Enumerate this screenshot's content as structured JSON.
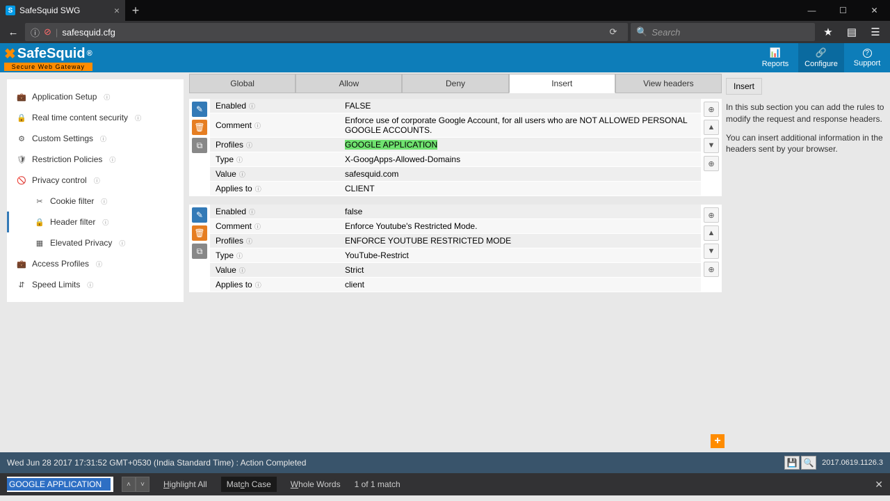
{
  "browser": {
    "tab_title": "SafeSquid SWG",
    "url": "safesquid.cfg",
    "search_placeholder": "Search"
  },
  "header": {
    "logo_main": "SafeSquid",
    "logo_reg": "®",
    "logo_sub": "Secure Web Gateway",
    "nav": [
      {
        "icon": "📊",
        "label": "Reports"
      },
      {
        "icon": "🔗",
        "label": "Configure"
      },
      {
        "icon": "?",
        "label": "Support"
      }
    ]
  },
  "sidebar": {
    "items": [
      {
        "icon": "💼",
        "label": "Application Setup"
      },
      {
        "icon": "🔒",
        "label": "Real time content security"
      },
      {
        "icon": "⚙",
        "label": "Custom Settings"
      },
      {
        "icon": "🛡",
        "label": "Restriction Policies"
      },
      {
        "icon": "🚫",
        "label": "Privacy control"
      }
    ],
    "subs": [
      {
        "icon": "✂",
        "label": "Cookie filter"
      },
      {
        "icon": "🔒",
        "label": "Header filter"
      },
      {
        "icon": "▦",
        "label": "Elevated Privacy"
      }
    ],
    "tail": [
      {
        "icon": "💼",
        "label": "Access Profiles"
      },
      {
        "icon": "⇵",
        "label": "Speed Limits"
      }
    ]
  },
  "tabs": [
    "Global",
    "Allow",
    "Deny",
    "Insert",
    "View headers"
  ],
  "entries": [
    {
      "rows": [
        {
          "label": "Enabled",
          "value": "FALSE"
        },
        {
          "label": "Comment",
          "value": "Enforce use of corporate Google Account, for all users who are NOT ALLOWED PERSONAL GOOGLE ACCOUNTS."
        },
        {
          "label": "Profiles",
          "value": "GOOGLE APPLICATION",
          "highlight": true
        },
        {
          "label": "Type",
          "value": "X-GoogApps-Allowed-Domains"
        },
        {
          "label": "Value",
          "value": "safesquid.com"
        },
        {
          "label": "Applies to",
          "value": "CLIENT"
        }
      ]
    },
    {
      "rows": [
        {
          "label": "Enabled",
          "value": "false"
        },
        {
          "label": "Comment",
          "value": "Enforce Youtube's Restricted Mode."
        },
        {
          "label": "Profiles",
          "value": "ENFORCE YOUTUBE RESTRICTED MODE"
        },
        {
          "label": "Type",
          "value": "YouTube-Restrict"
        },
        {
          "label": "Value",
          "value": "Strict"
        },
        {
          "label": "Applies to",
          "value": "client"
        }
      ]
    }
  ],
  "right": {
    "title": "Insert",
    "p1": "In this sub section you can add the rules to modify the request and response headers.",
    "p2": "You can insert additional information in the headers sent by your browser."
  },
  "status": {
    "text": "Wed Jun 28 2017 17:31:52 GMT+0530 (India Standard Time) : Action Completed",
    "version": "2017.0619.1126.3"
  },
  "find": {
    "value": "GOOGLE APPLICATION",
    "highlight_all": "Highlight All",
    "match_case": "Match Case",
    "whole_words": "Whole Words",
    "matches": "1 of 1 match"
  }
}
